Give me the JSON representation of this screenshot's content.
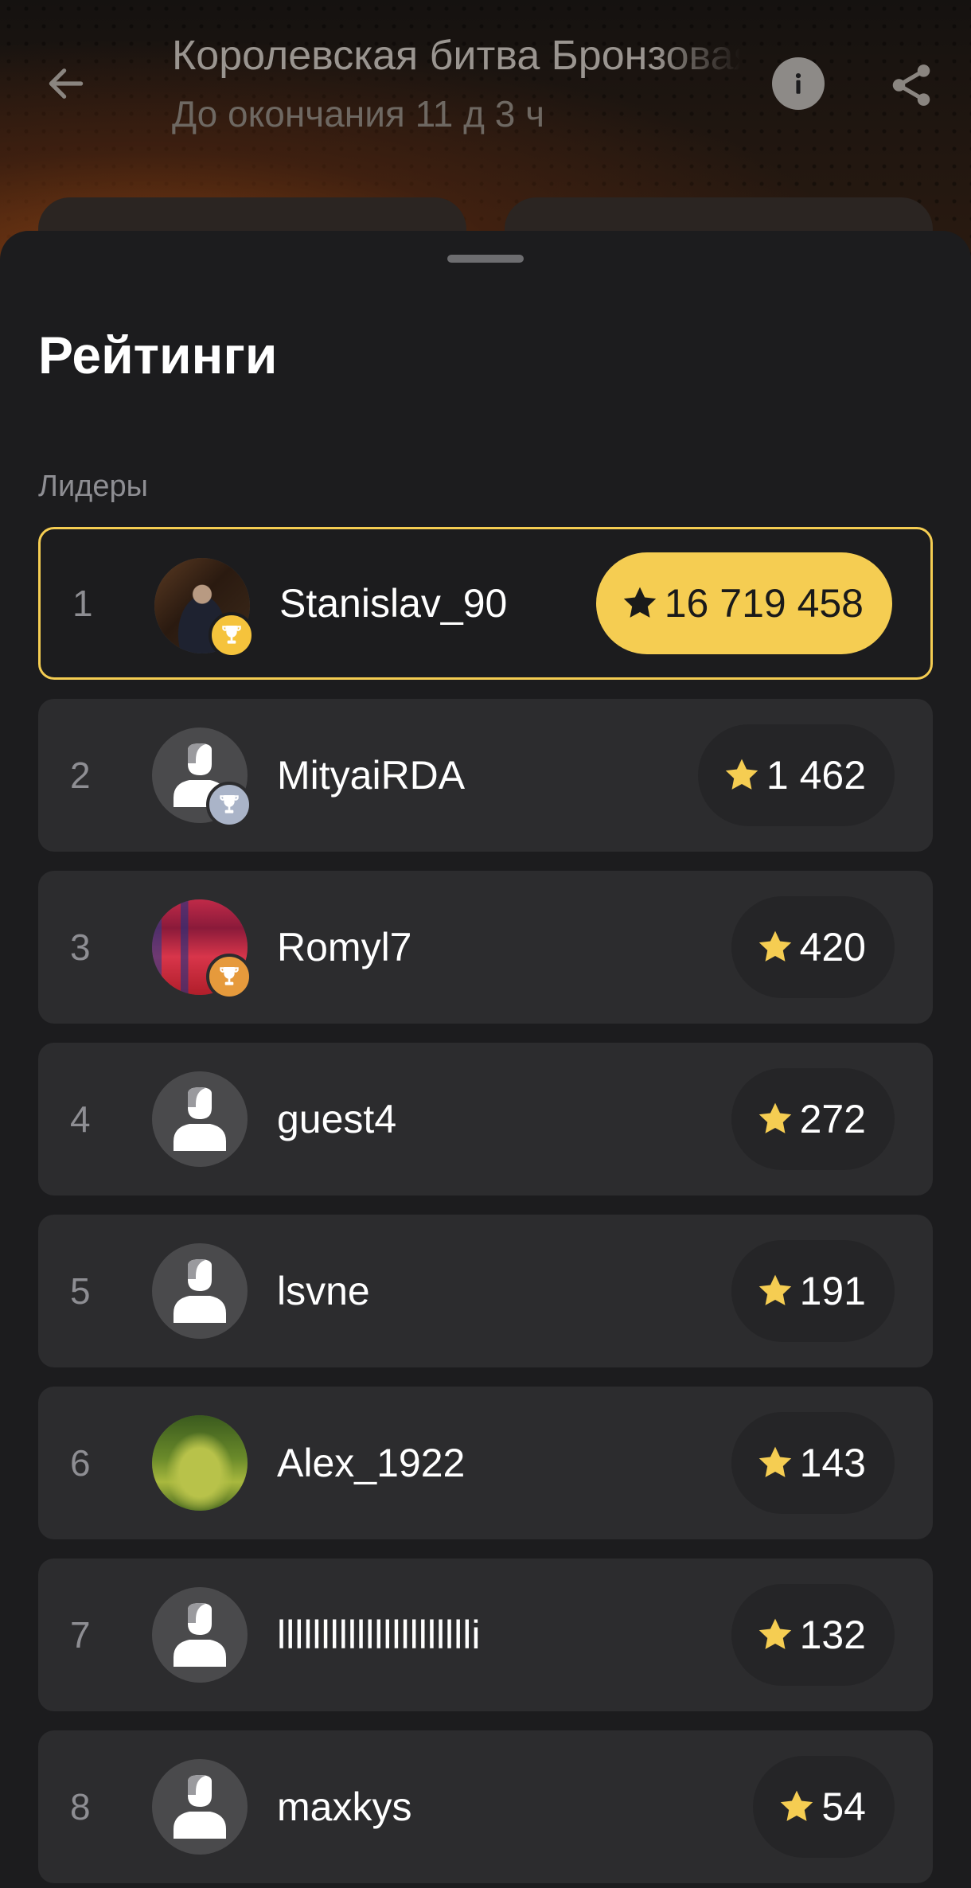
{
  "header": {
    "title": "Королевская битва Бронзовая",
    "subtitle": "До окончания 11 д 3 ч"
  },
  "sheet": {
    "title": "Рейтинги",
    "section_label": "Лидеры"
  },
  "colors": {
    "accent": "#f5cd52",
    "sheet_bg": "#1c1c1e",
    "row_bg": "#2c2c2e"
  },
  "leaders": [
    {
      "rank": "1",
      "name": "Stanislav_90",
      "score": "16 719 458",
      "avatar": "photo-man-suit",
      "badge": "gold-trophy-icon"
    },
    {
      "rank": "2",
      "name": "MityaiRDA",
      "score": "1 462",
      "avatar": "default-user-icon",
      "badge": "silver-trophy-icon"
    },
    {
      "rank": "3",
      "name": "Romyl7",
      "score": "420",
      "avatar": "photo-red-abstract",
      "badge": "bronze-trophy-icon"
    },
    {
      "rank": "4",
      "name": "guest4",
      "score": "272",
      "avatar": "default-user-icon",
      "badge": ""
    },
    {
      "rank": "5",
      "name": "lsvne",
      "score": "191",
      "avatar": "default-user-icon",
      "badge": ""
    },
    {
      "rank": "6",
      "name": "Alex_1922",
      "score": "143",
      "avatar": "photo-green-moss",
      "badge": ""
    },
    {
      "rank": "7",
      "name": "lllllllllllllllllllllli",
      "score": "132",
      "avatar": "default-user-icon",
      "badge": ""
    },
    {
      "rank": "8",
      "name": "maxkys",
      "score": "54",
      "avatar": "default-user-icon",
      "badge": ""
    }
  ]
}
